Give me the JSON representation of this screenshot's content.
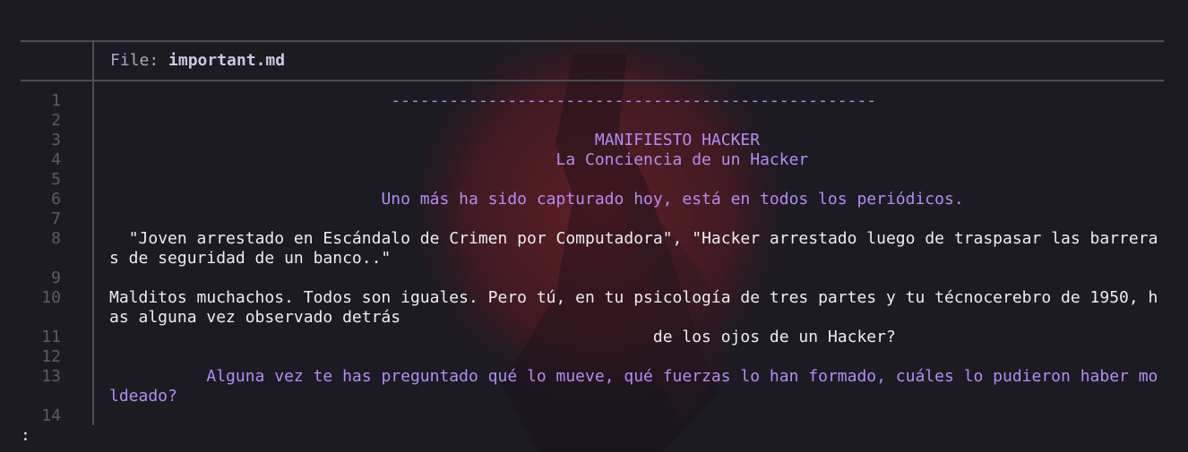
{
  "header": {
    "label": "File: ",
    "filename": "important.md"
  },
  "lines": [
    {
      "n": "1",
      "text": "                             --------------------------------------------------",
      "color": "purple"
    },
    {
      "n": "2",
      "text": "",
      "color": "white"
    },
    {
      "n": "3",
      "text": "                                                  MANIFIESTO HACKER",
      "color": "purple"
    },
    {
      "n": "4",
      "text": "                                              La Conciencia de un Hacker",
      "color": "purple"
    },
    {
      "n": "5",
      "text": "",
      "color": "white"
    },
    {
      "n": "6",
      "text": "                            Uno más ha sido capturado hoy, está en todos los periódicos.",
      "color": "purple"
    },
    {
      "n": "7",
      "text": "",
      "color": "white"
    },
    {
      "n": "8",
      "text": "  \"Joven arrestado en Escándalo de Crimen por Computadora\", \"Hacker arrestado luego de traspasar las barreras de seguridad de un banco..\"",
      "color": "white"
    },
    {
      "n": "9",
      "text": "",
      "color": "white"
    },
    {
      "n": "10",
      "text": "Malditos muchachos. Todos son iguales. Pero tú, en tu psicología de tres partes y tu técnocerebro de 1950, has alguna vez observado detrás",
      "color": "white"
    },
    {
      "n": "11",
      "text": "                                                        de los ojos de un Hacker?",
      "color": "white"
    },
    {
      "n": "12",
      "text": "",
      "color": "white"
    },
    {
      "n": "13",
      "text": "          Alguna vez te has preguntado qué lo mueve, qué fuerzas lo han formado, cuáles lo pudieron haber moldeado?",
      "color": "purple"
    },
    {
      "n": "14",
      "text": "",
      "color": "white"
    }
  ],
  "prompt": ":",
  "colors": {
    "background": "#1c1b22",
    "accent": "#b48cf2",
    "text": "#ececf2",
    "line_number": "#5c5c66",
    "rule": "#4d4d55"
  }
}
